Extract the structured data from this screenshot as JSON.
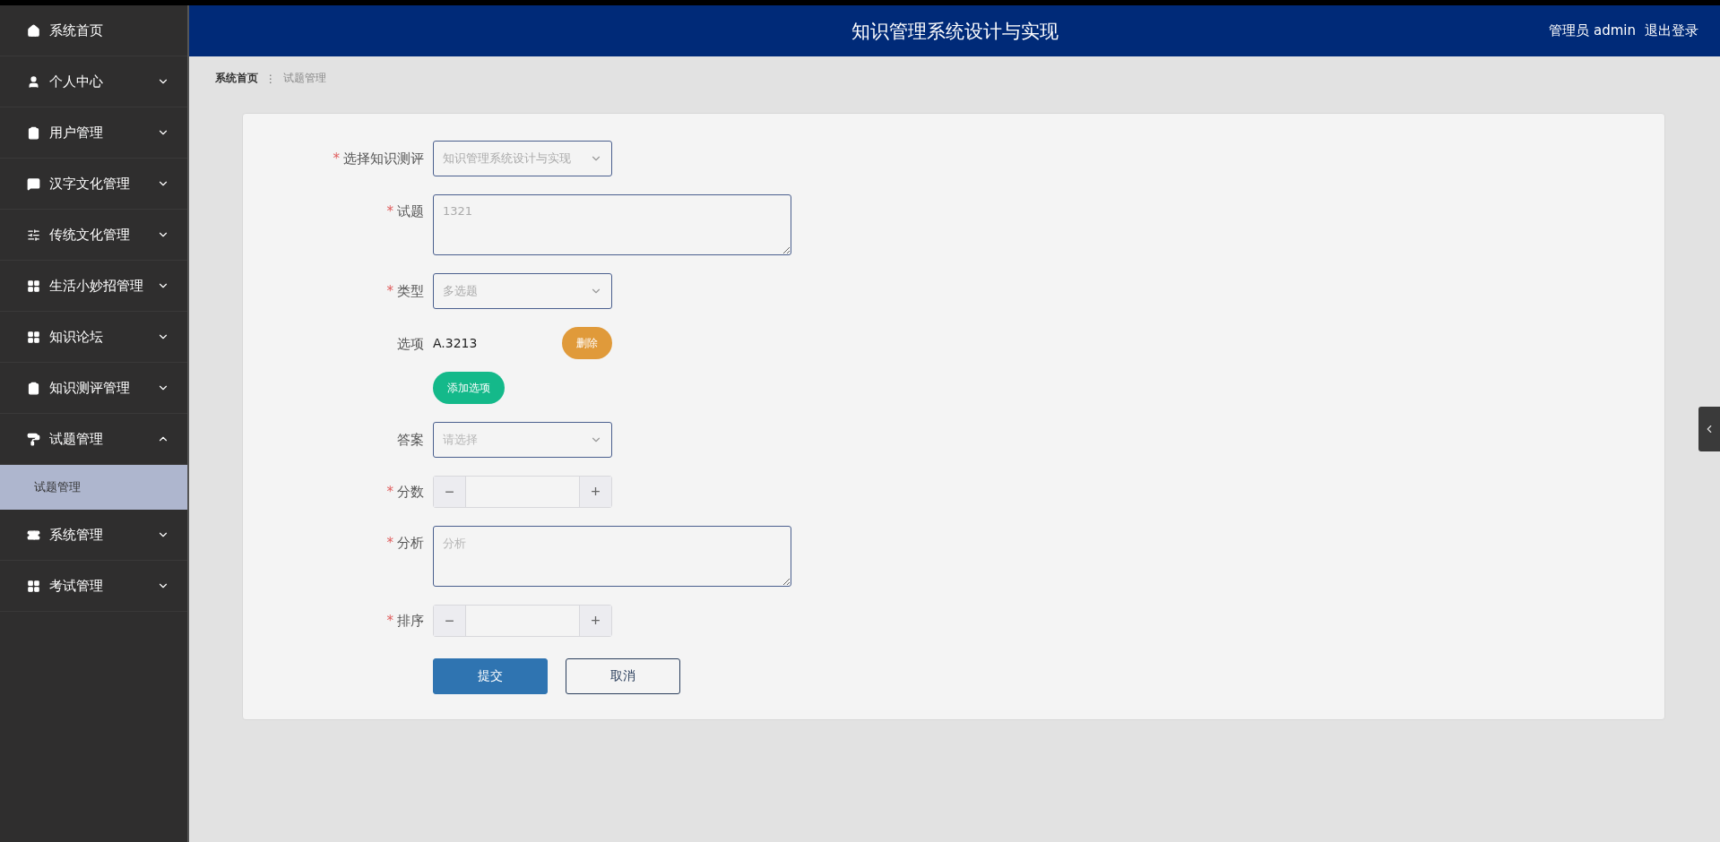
{
  "sidebar": {
    "items": [
      {
        "label": "系统首页"
      },
      {
        "label": "个人中心",
        "expanded": false
      },
      {
        "label": "用户管理",
        "expanded": false
      },
      {
        "label": "汉字文化管理",
        "expanded": false
      },
      {
        "label": "传统文化管理",
        "expanded": false
      },
      {
        "label": "生活小妙招管理",
        "expanded": false
      },
      {
        "label": "知识论坛",
        "expanded": false
      },
      {
        "label": "知识测评管理",
        "expanded": false
      },
      {
        "label": "试题管理",
        "expanded": true,
        "children": [
          {
            "label": "试题管理",
            "selected": true
          }
        ]
      },
      {
        "label": "系统管理",
        "expanded": false
      },
      {
        "label": "考试管理",
        "expanded": false
      }
    ]
  },
  "header": {
    "title": "知识管理系统设计与实现",
    "user": "管理员 admin",
    "logout": "退出登录"
  },
  "breadcrumb": {
    "separator": "⋮",
    "items": [
      "系统首页",
      "试题管理"
    ]
  },
  "form": {
    "fields": [
      {
        "kind": "select",
        "label": "选择知识测评",
        "required_mark": "*",
        "value": "知识管理系统设计与实现",
        "disabled": true
      },
      {
        "kind": "textarea",
        "label": "试题",
        "required_mark": "*",
        "value": "1321",
        "disabled": true
      },
      {
        "kind": "select",
        "label": "类型",
        "required_mark": "*",
        "value": "多选题",
        "disabled": true
      },
      {
        "kind": "options",
        "label": "选项",
        "options": [
          {
            "text": "A.3213",
            "action": "删除"
          }
        ],
        "add": "添加选项"
      },
      {
        "kind": "select",
        "label": "答案",
        "placeholder": "请选择"
      },
      {
        "kind": "number",
        "label": "分数",
        "required_mark": "*",
        "minus": "−",
        "plus": "+"
      },
      {
        "kind": "textarea",
        "label": "分析",
        "required_mark": "*",
        "placeholder": "分析"
      },
      {
        "kind": "number",
        "label": "排序",
        "required_mark": "*",
        "minus": "−",
        "plus": "+"
      }
    ],
    "buttons": [
      {
        "kind": "primary",
        "label": "提交"
      },
      {
        "kind": "outline",
        "label": "取消"
      }
    ]
  }
}
